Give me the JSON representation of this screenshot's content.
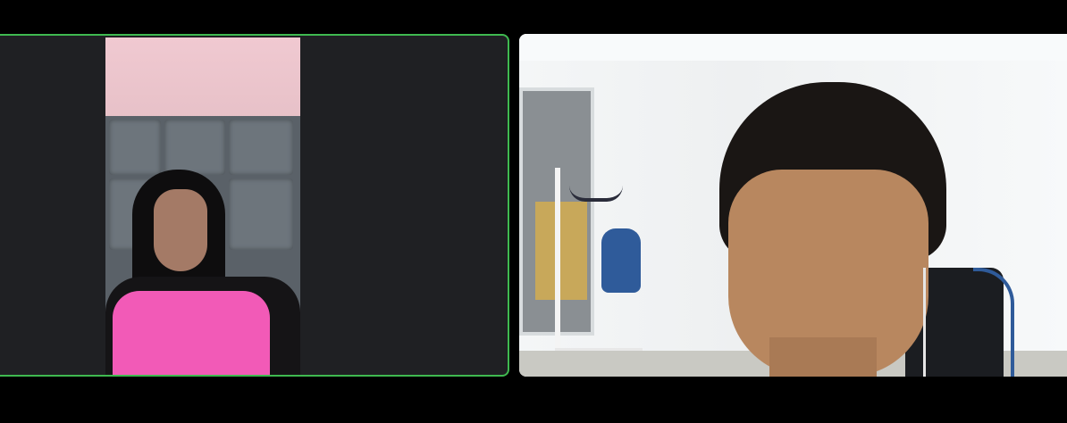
{
  "meeting": {
    "view": "gallery",
    "participant_count": 2
  },
  "participants": [
    {
      "position": "left",
      "active_speaker": true,
      "video_on": true,
      "highlight_color": "#3fb950",
      "tile_background": "#1f2023"
    },
    {
      "position": "right",
      "active_speaker": false,
      "video_on": true
    }
  ],
  "colors": {
    "window_background": "#000000",
    "active_speaker_border": "#3fb950"
  }
}
